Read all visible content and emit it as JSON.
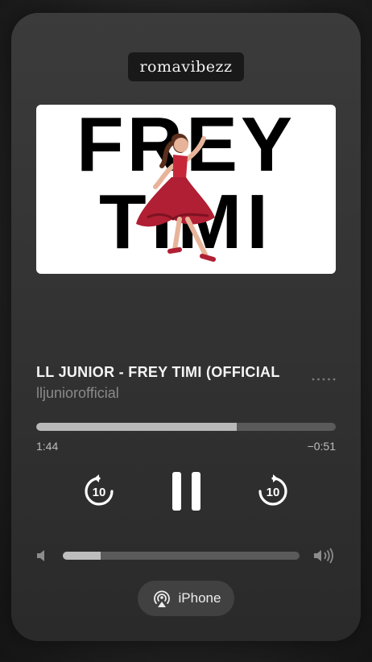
{
  "overlay": {
    "username": "romavibezz"
  },
  "artwork": {
    "line1": "FREY",
    "line2": "TIMI"
  },
  "track": {
    "title": "LL JUNIOR - FREY TIMI (OFFICIAL",
    "artist": "lljuniorofficial"
  },
  "playback": {
    "elapsed": "1:44",
    "remaining": "−0:51",
    "progress": 0.67,
    "state": "playing"
  },
  "controls": {
    "skip_back": "10",
    "skip_forward": "10"
  },
  "volume": {
    "level": 0.16
  },
  "output": {
    "device_label": "iPhone",
    "icon": "airplay-audio-icon"
  },
  "icons": [
    "more-icon",
    "rewind-10-icon",
    "pause-icon",
    "forward-10-icon",
    "volume-low-icon",
    "volume-high-icon",
    "airplay-audio-icon"
  ],
  "colors": {
    "progress_fill": "#b9b9b9",
    "track": "#5a5a5a",
    "secondary_text": "#8a8a8a"
  }
}
